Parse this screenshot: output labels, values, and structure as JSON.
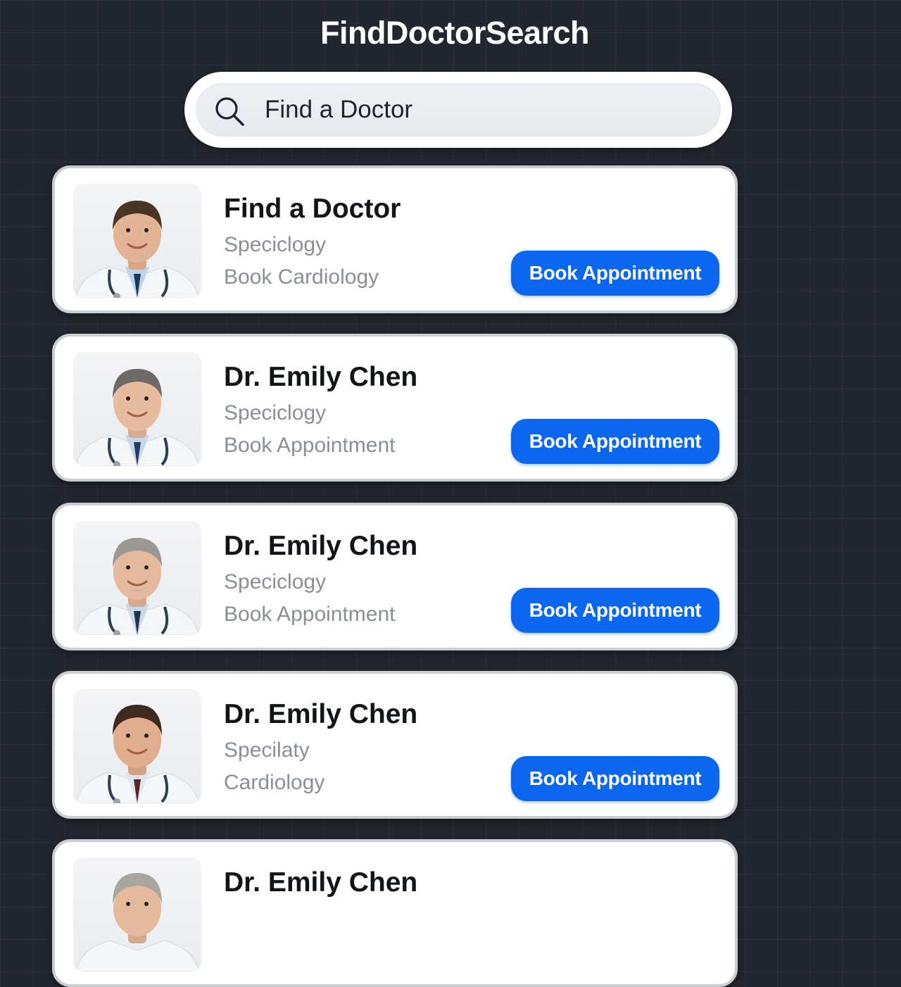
{
  "app": {
    "title": "FindDoctorSearch"
  },
  "search": {
    "value": "Find a Doctor",
    "icon": "search-icon"
  },
  "colors": {
    "background": "#22262e",
    "accent": "#0b66f0",
    "card": "#ffffff"
  },
  "doctors": [
    {
      "name": "Find a Doctor",
      "line1": "Speciclogy",
      "line2": "Book Cardiology",
      "button": "Book Appointment"
    },
    {
      "name": "Dr. Emily Chen",
      "line1": "Speciclogy",
      "line2": "Book Appointment",
      "button": "Book Appointment"
    },
    {
      "name": "Dr. Emily Chen",
      "line1": "Speciclogy",
      "line2": "Book Appointment",
      "button": "Book Appointment"
    },
    {
      "name": "Dr. Emily Chen",
      "line1": "Specilaty",
      "line2": "Cardiology",
      "button": "Book Appointment"
    },
    {
      "name": "Dr. Emily Chen"
    }
  ]
}
